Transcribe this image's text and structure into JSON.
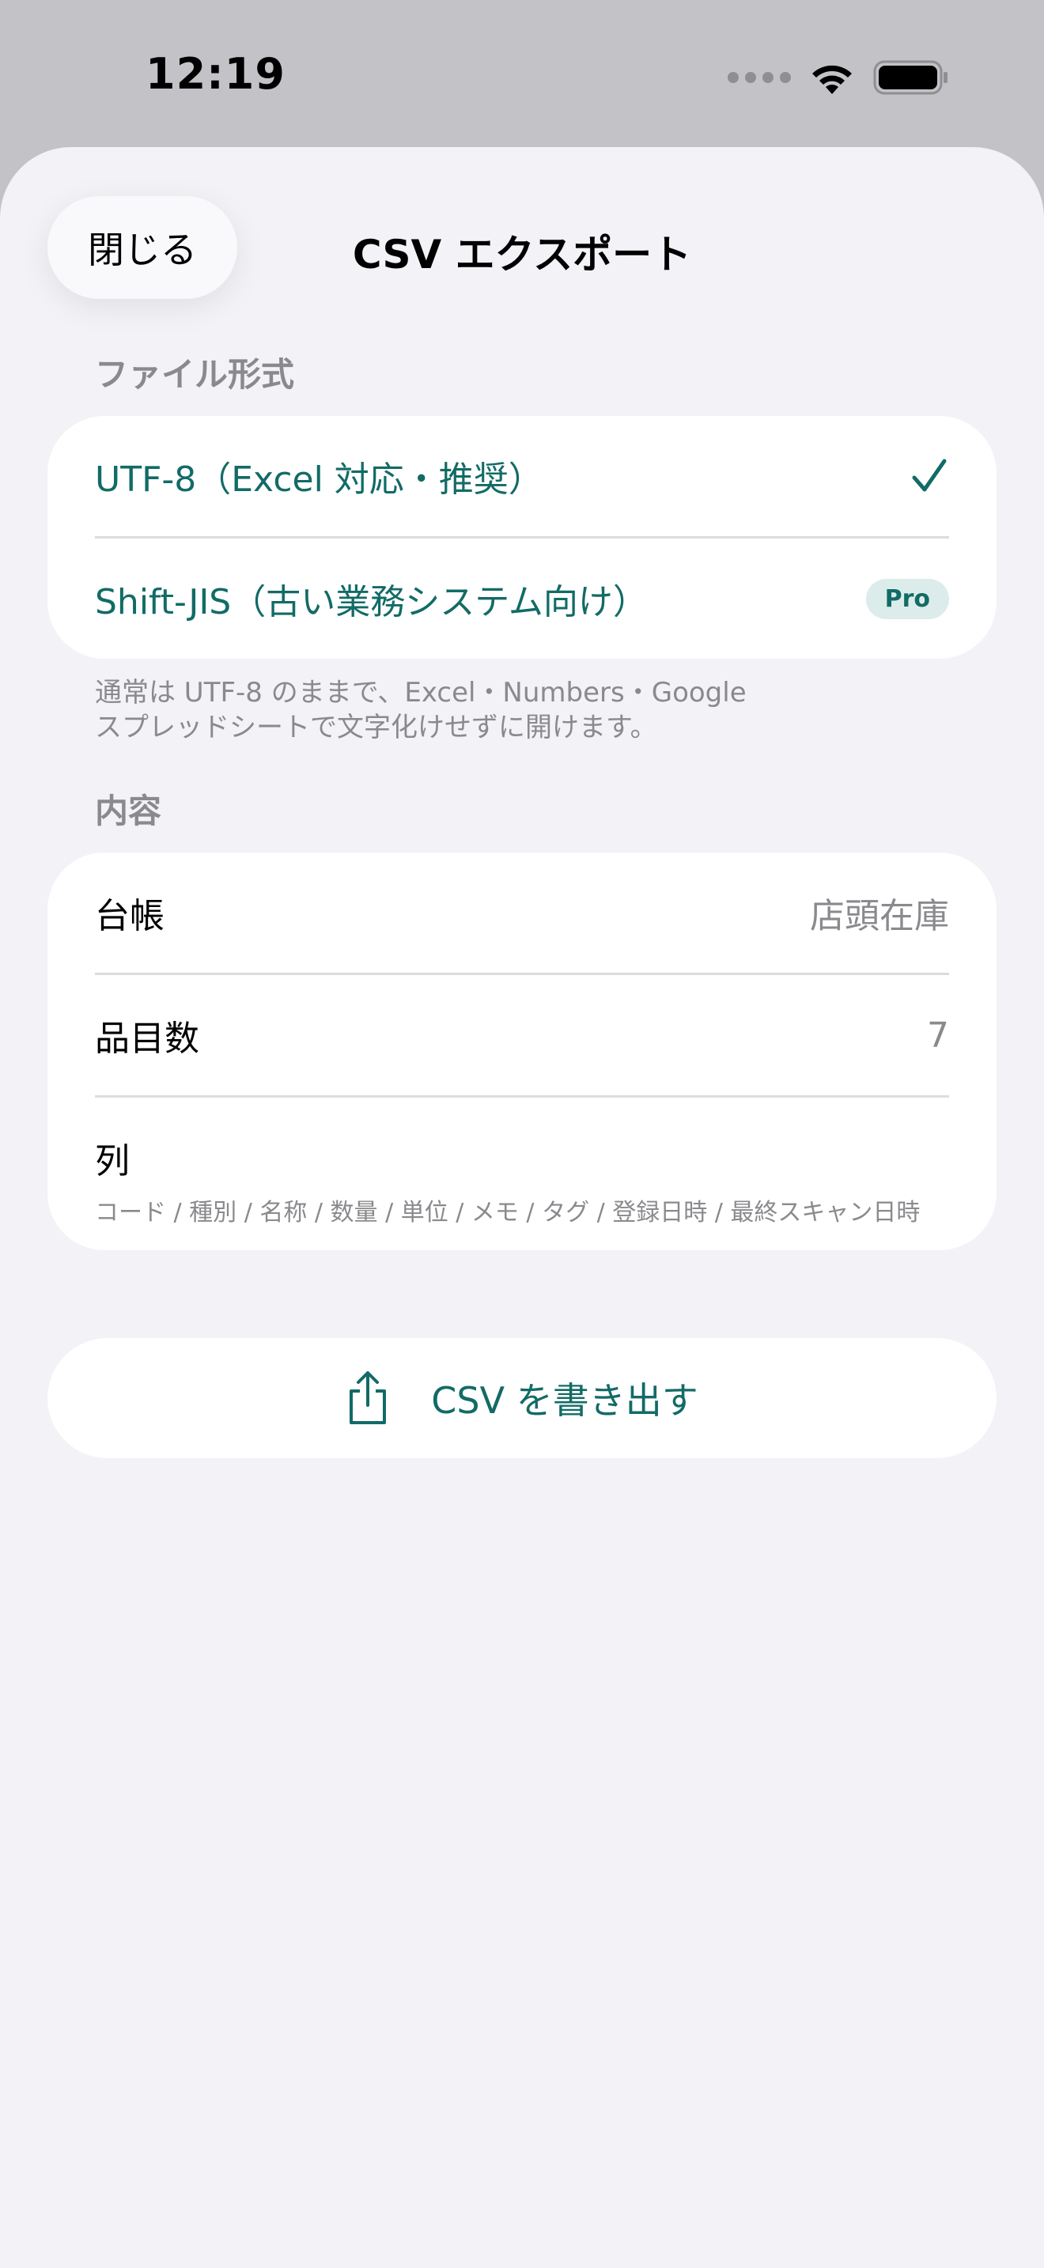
{
  "status_bar": {
    "time": "12:19"
  },
  "sheet": {
    "close_label": "閉じる",
    "title": "CSV エクスポート"
  },
  "file_format": {
    "header": "ファイル形式",
    "options": [
      {
        "label": "UTF-8（Excel 対応・推奨）",
        "selected": true
      },
      {
        "label": "Shift-JIS（古い業務システム向け）",
        "badge": "Pro"
      }
    ],
    "note_line1": "通常は UTF-8 のままで、Excel・Numbers・Google",
    "note_line2": "スプレッドシートで文字化けせずに開けます。"
  },
  "content": {
    "header": "内容",
    "ledger_label": "台帳",
    "ledger_value": "店頭在庫",
    "item_count_label": "品目数",
    "item_count_value": "7",
    "columns_label": "列",
    "columns_value": "コード / 種別 / 名称 / 数量 / 単位 / メモ / タグ / 登録日時 / 最終スキャン日時"
  },
  "export": {
    "label": "CSV を書き出す",
    "icon": "share-icon"
  },
  "colors": {
    "accent": "#126b66",
    "background": "#f2f2f7",
    "secondary_text": "#8a8a8e"
  }
}
